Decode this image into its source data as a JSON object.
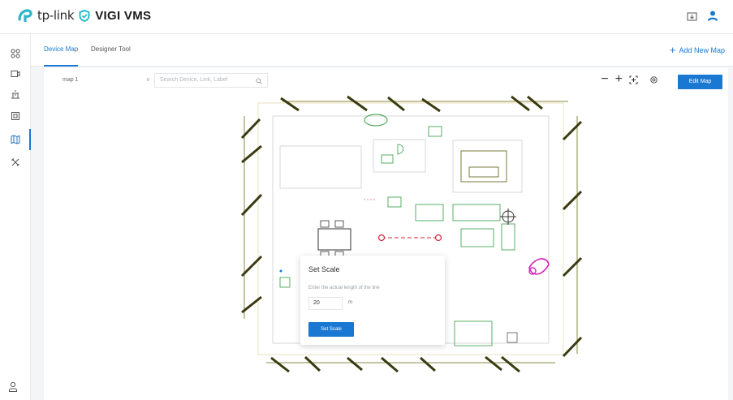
{
  "brand": {
    "tplink": "tp-link",
    "product": "VIGI VMS"
  },
  "tabs": [
    {
      "label": "Device Map",
      "active": true
    },
    {
      "label": "Designer Tool",
      "active": false
    }
  ],
  "add_new_map": "Add New Map",
  "map_select": {
    "value": "map 1"
  },
  "search": {
    "placeholder": "Search Device, Link, Label"
  },
  "toolbar": {
    "edit_map_label": "Edit Map"
  },
  "dialog": {
    "title": "Set Scale",
    "hint": "Enter the actual length of the line",
    "value": "20",
    "unit": "m",
    "button": "Set Scale"
  },
  "colors": {
    "accent": "#1a78d2",
    "plan_line": "#7a7a3c",
    "scale_line": "#d0243a",
    "device": "#d61fb8"
  }
}
